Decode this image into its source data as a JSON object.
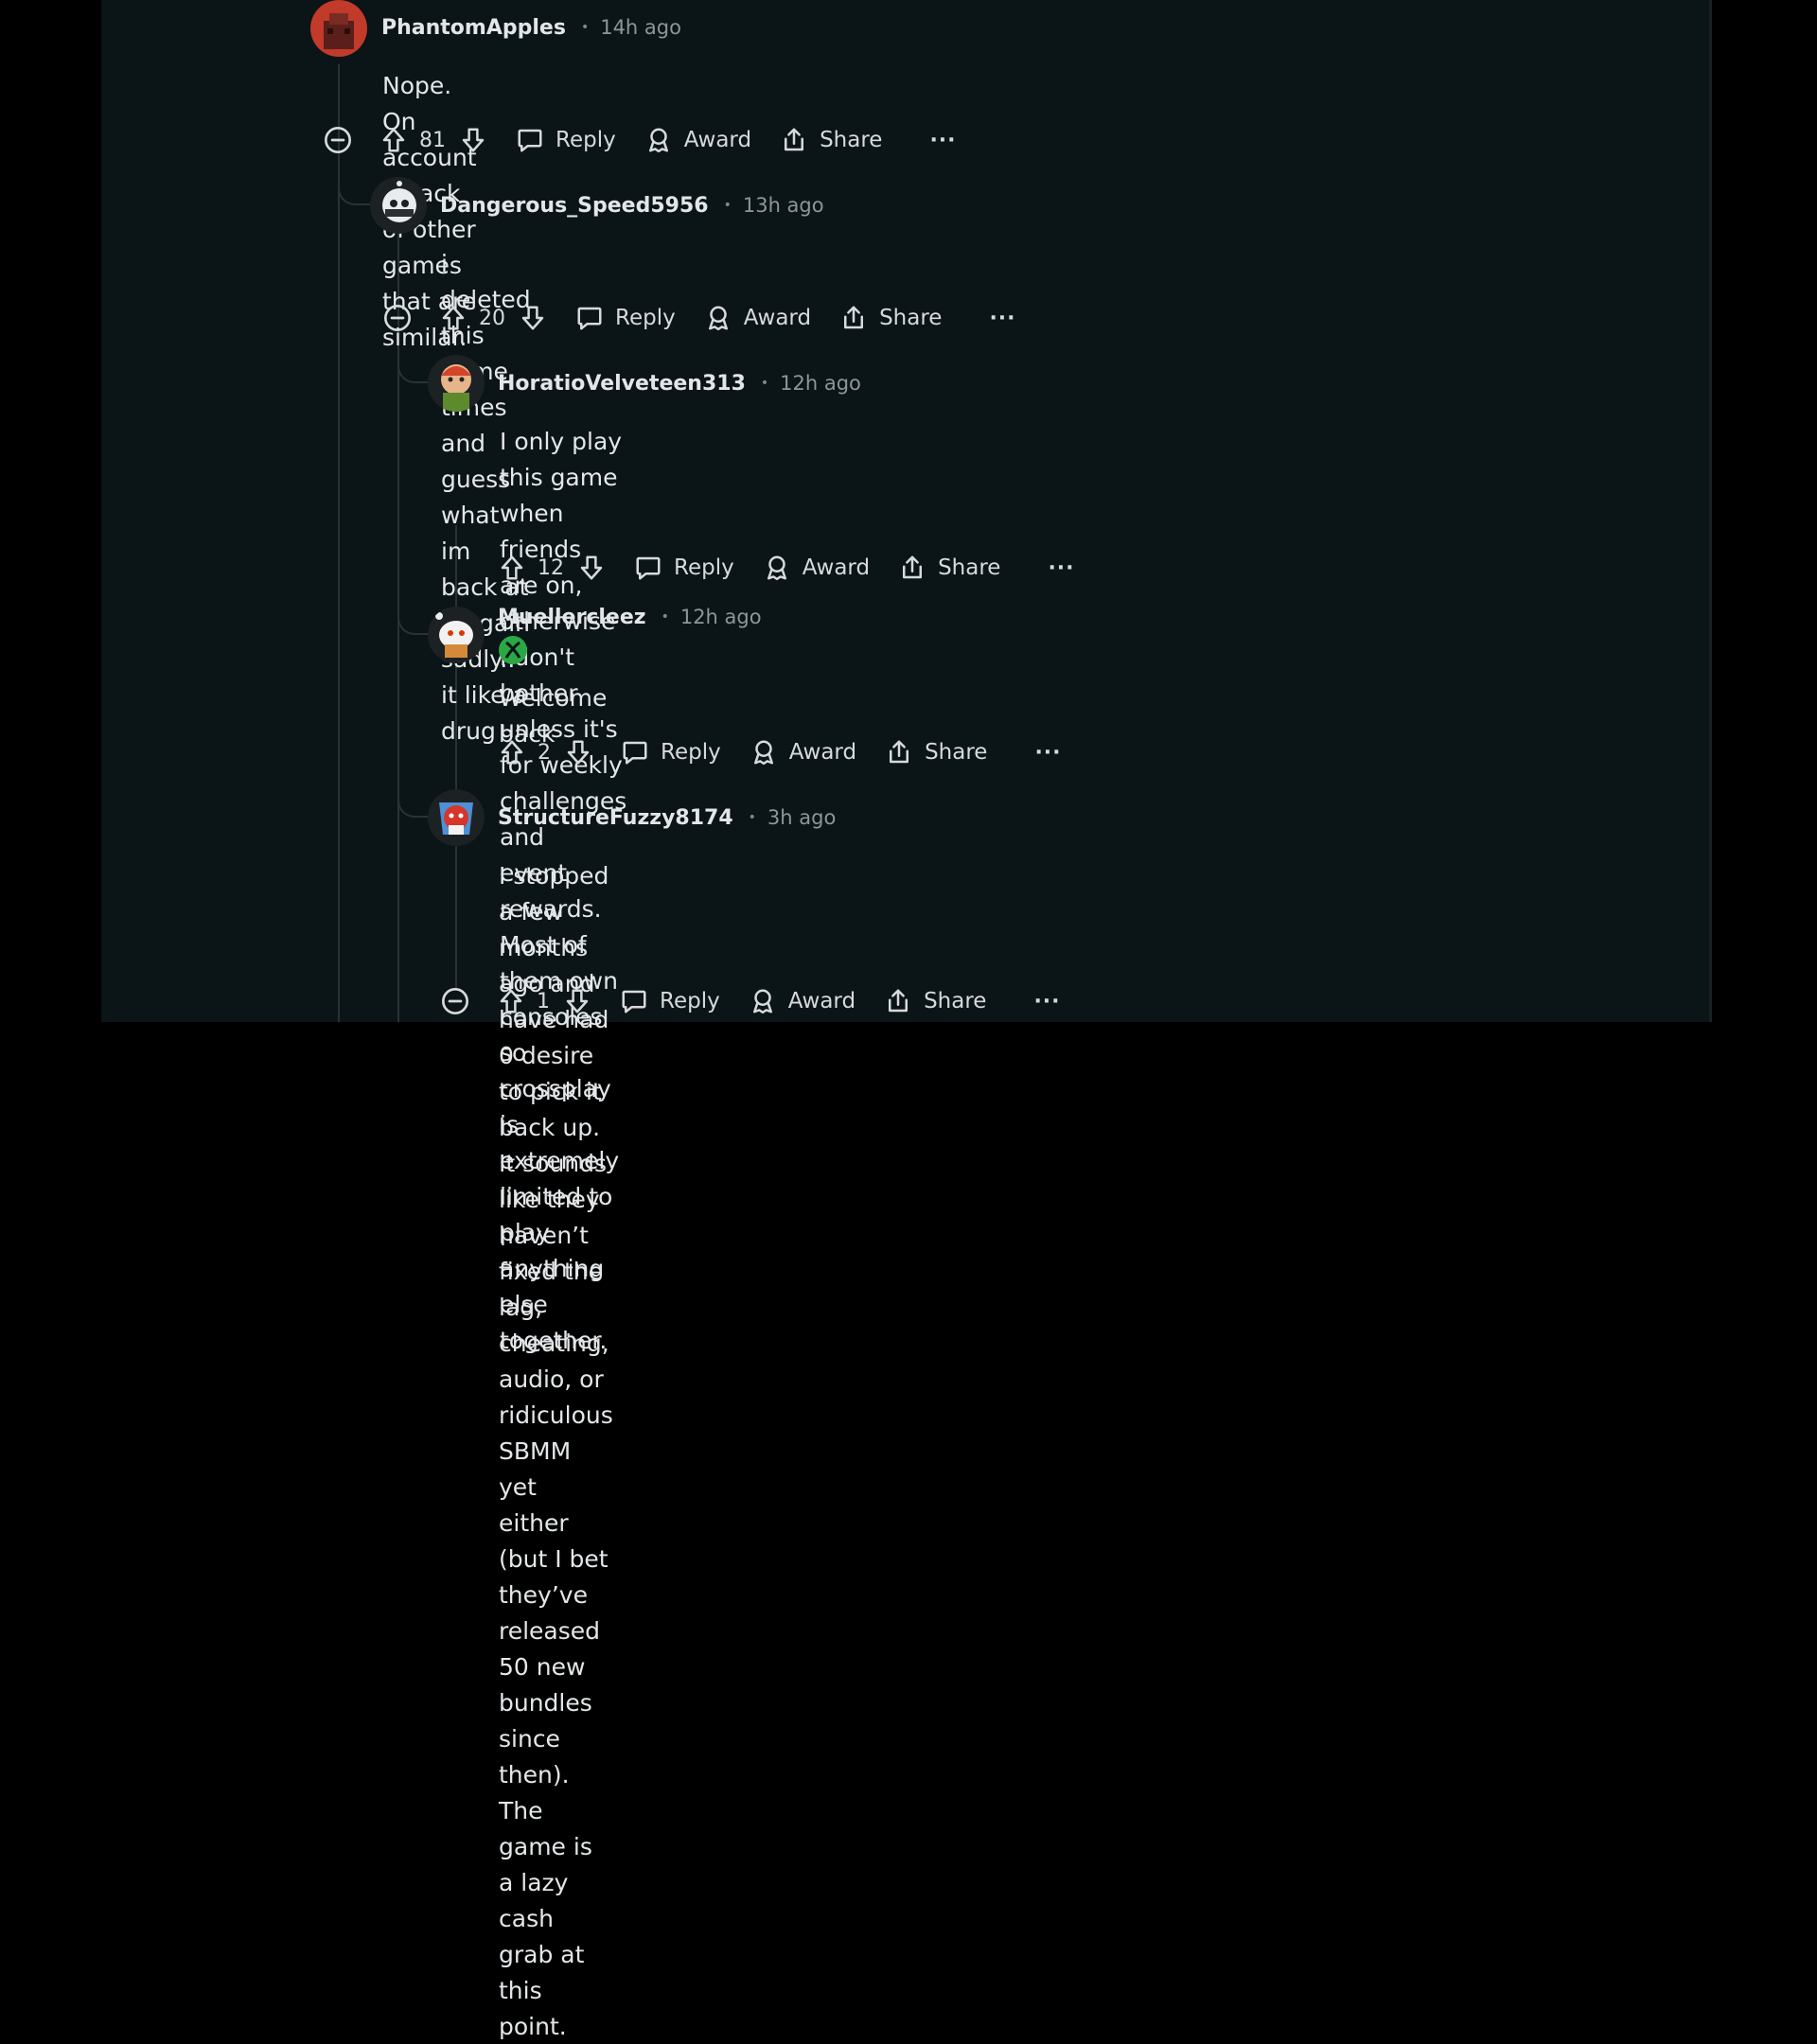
{
  "colors": {
    "panel": "#0b1416",
    "page": "#000000",
    "thread_line": "#2a3236",
    "flair_green": "#2aa846"
  },
  "icons": [
    "collapse-icon",
    "upvote-icon",
    "downvote-icon",
    "reply-icon",
    "award-icon",
    "share-icon",
    "more-icon"
  ],
  "comments": [
    {
      "username": "PhantomApples",
      "time": "14h ago",
      "body": [
        "Nope. On account of lack of other games that are similar."
      ],
      "score": "81",
      "reply": "Reply",
      "award": "Award",
      "share": "Share",
      "more": "···"
    },
    {
      "username": "Dangerous_Speed5956",
      "time": "13h ago",
      "body": [
        "i deleted this game times and guess what im back at it again sadly.. it like a drug"
      ],
      "score": "20",
      "reply": "Reply",
      "award": "Award",
      "share": "Share",
      "more": "···"
    },
    {
      "username": "HoratioVelveteen313",
      "time": "12h ago",
      "body": [
        "I only play this game when friends are on, otherwise I don't bother unless it's for weekly challenges and",
        "event rewards. Most of them own consoles so crossplay is extremely limited to play anything else",
        "together."
      ],
      "score": "12",
      "reply": "Reply",
      "award": "Award",
      "share": "Share",
      "more": "···"
    },
    {
      "username": "Muellercleez",
      "time": "12h ago",
      "flair": "xbox-icon",
      "body": [
        "Welcome back"
      ],
      "score": "2",
      "reply": "Reply",
      "award": "Award",
      "share": "Share",
      "more": "···"
    },
    {
      "username": "StructureFuzzy8174",
      "time": "3h ago",
      "body": [
        "I stopped a few months ago and have had 0 desire to pick it back up. It sounds like they haven’t fixed the",
        "lag, cheating, audio, or ridiculous SBMM yet either (but I bet they’ve released 50 new bundles since then).",
        "The game is a lazy cash grab at this point."
      ],
      "score": "1",
      "reply": "Reply",
      "award": "Award",
      "share": "Share",
      "more": "···"
    }
  ]
}
